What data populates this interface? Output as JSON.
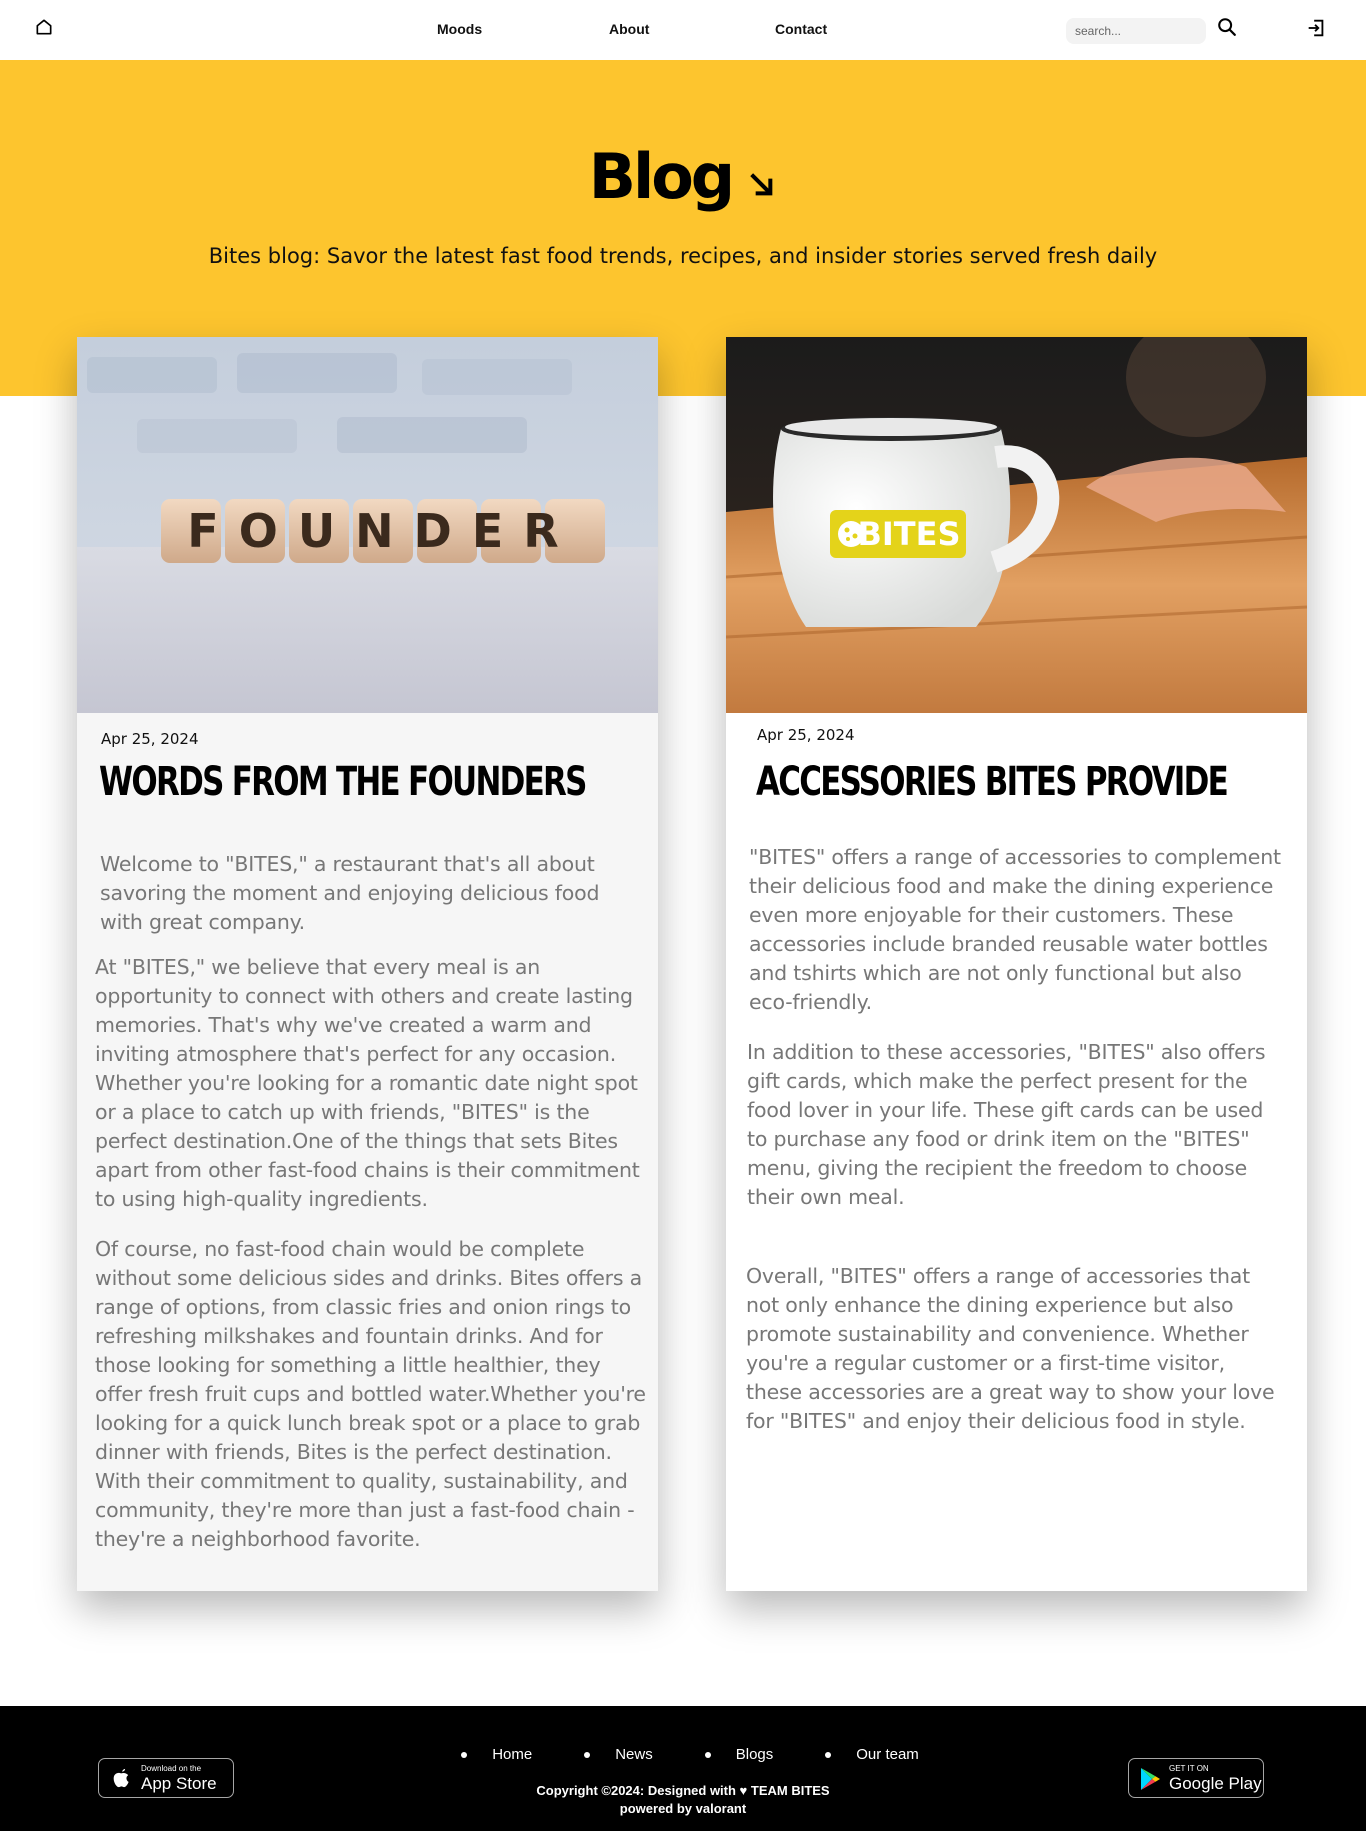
{
  "nav": {
    "links": [
      "Moods",
      "About",
      "Contact"
    ],
    "search_placeholder": "search..."
  },
  "hero": {
    "title": "Blog",
    "subtitle": "Bites blog: Savor the latest fast food trends, recipes, and insider stories served fresh daily"
  },
  "posts": [
    {
      "image_text": "FOUNDER",
      "date": "Apr 25, 2024",
      "title": "Words from the founders",
      "paragraphs": [
        "Welcome to \"BITES,\" a restaurant that's all about savoring the moment and enjoying delicious food with great company.",
        "At \"BITES,\" we believe that every meal is an opportunity to connect with others and create lasting memories. That's why we've created a warm and inviting atmosphere that's perfect for any occasion. Whether you're looking for a romantic date night spot or a place to catch up with friends, \"BITES\" is the perfect destination.One of the things that sets Bites apart from other fast-food chains is their commitment to using high-quality ingredients.",
        "Of course, no fast-food chain would be complete without some delicious sides and drinks. Bites offers a range of options, from classic fries and onion rings to refreshing milkshakes and fountain drinks. And for those looking for something a little healthier, they offer fresh fruit cups and bottled water.Whether you're looking for a quick lunch break spot or a place to grab dinner with friends, Bites is the perfect destination. With their commitment to quality, sustainability, and community, they're more than just a fast-food chain - they're a neighborhood favorite."
      ]
    },
    {
      "image_text": "BITES",
      "date": "Apr 25, 2024",
      "title": "Accessories Bites provide",
      "paragraphs": [
        "\"BITES\" offers a range of accessories to complement their delicious food and make the dining experience even more enjoyable for their customers. These accessories include branded reusable water bottles and tshirts which are not only functional but also eco-friendly.",
        "In addition to these accessories, \"BITES\" also offers gift cards, which make the perfect present for the food lover in your life. These gift cards can be used to purchase any food or drink item on the \"BITES\" menu, giving the recipient the freedom to choose their own meal.",
        "Overall, \"BITES\" offers a range of accessories that not only enhance the dining experience but also promote sustainability and convenience. Whether you're a regular customer or a first-time visitor, these accessories are a great way to show your love for \"BITES\" and enjoy their delicious food in style."
      ]
    }
  ],
  "footer": {
    "links": [
      "Home",
      "News",
      "Blogs",
      "Our team"
    ],
    "copyright": "Copyright ©2024: Designed with ♥ TEAM BITES",
    "powered": "powered by valorant",
    "app_store": {
      "small": "Download on the",
      "big": "App Store"
    },
    "google_play": {
      "small": "GET IT ON",
      "big": "Google Play"
    }
  },
  "colors": {
    "accent_yellow": "#fdc52e",
    "footer_bg": "#000000",
    "body_text_gray": "#777777"
  },
  "icons": [
    "home-icon",
    "search-icon",
    "login-icon",
    "arrow-down-right-icon",
    "apple-icon",
    "google-play-icon"
  ]
}
